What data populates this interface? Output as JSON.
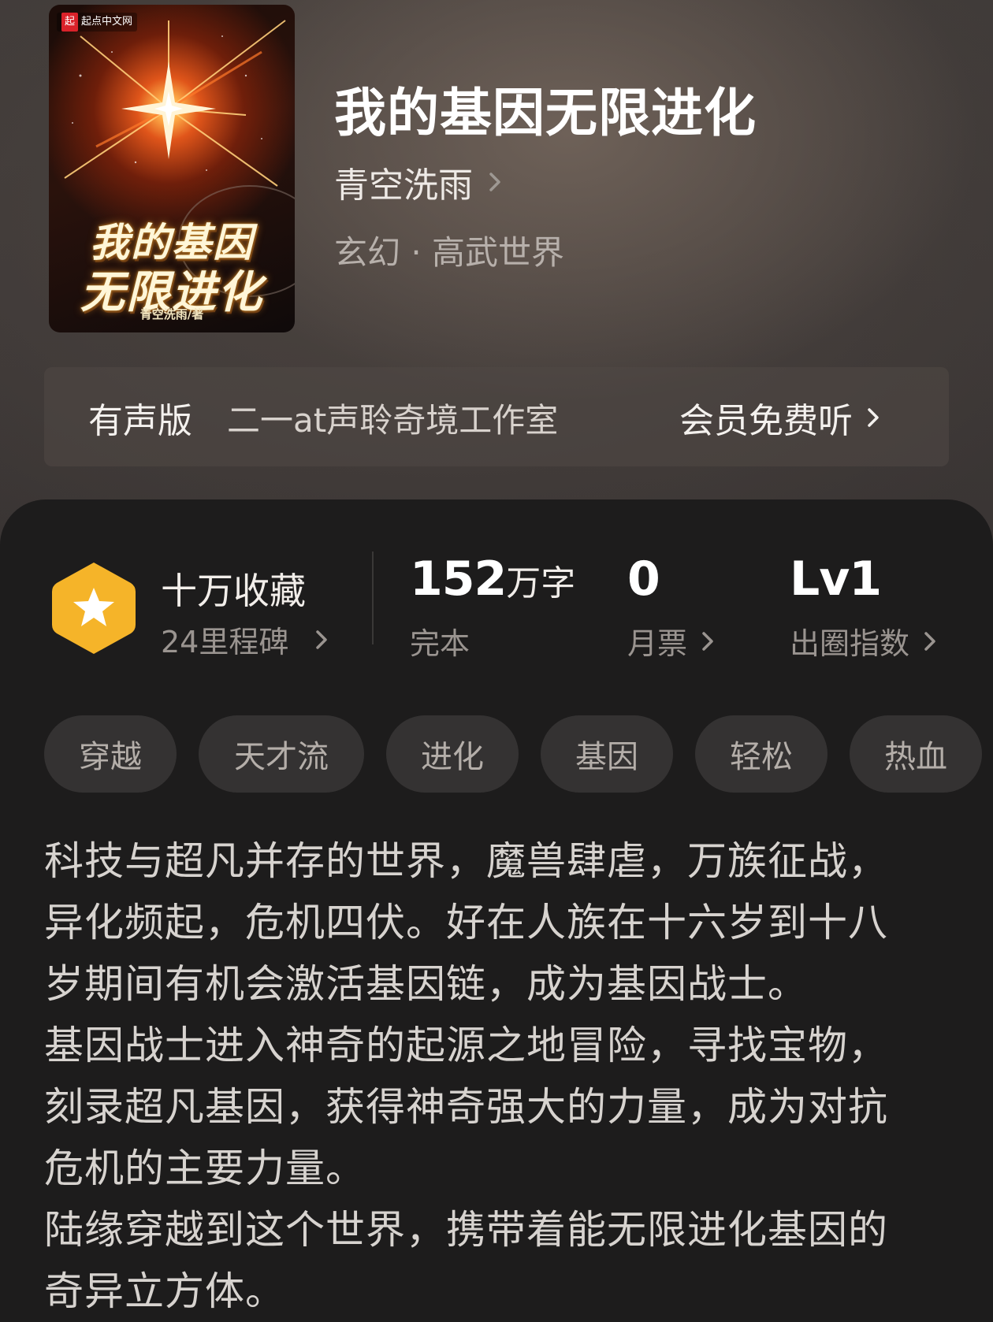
{
  "cover": {
    "publisher": "起点中文网",
    "publisher_mark": "起",
    "title_line1": "我的基因",
    "title_line2": "无限进化",
    "author_line": "青空洗雨/著"
  },
  "book": {
    "title": "我的基因无限进化",
    "author": "青空洗雨",
    "genre": "玄幻 · 高武世界"
  },
  "audio": {
    "label": "有声版",
    "studio": "二一at声聆奇境工作室",
    "cta": "会员免费听"
  },
  "stats": {
    "collection_title": "十万收藏",
    "milestone": "24里程碑",
    "word_count": "152",
    "word_unit": "万字",
    "status": "完本",
    "monthly_votes": "0",
    "monthly_votes_label": "月票",
    "level": "Lv1",
    "level_label": "出圈指数"
  },
  "tags": [
    "穿越",
    "天才流",
    "进化",
    "基因",
    "轻松",
    "热血"
  ],
  "description": {
    "p1": "科技与超凡并存的世界，魔兽肆虐，万族征战，\n异化频起，危机四伏。好在人族在十六岁到十八\n岁期间有机会激活基因链，成为基因战士。",
    "p2": "基因战士进入神奇的起源之地冒险，寻找宝物，\n刻录超凡基因，获得神奇强大的力量，成为对抗\n危机的主要力量。",
    "p3": "陆缘穿越到这个世界，携带着能无限进化基因的\n奇异立方体。"
  },
  "colors": {
    "badge": "#f5b429",
    "panel": "#1d1c1c",
    "tag_bg": "#343232"
  }
}
